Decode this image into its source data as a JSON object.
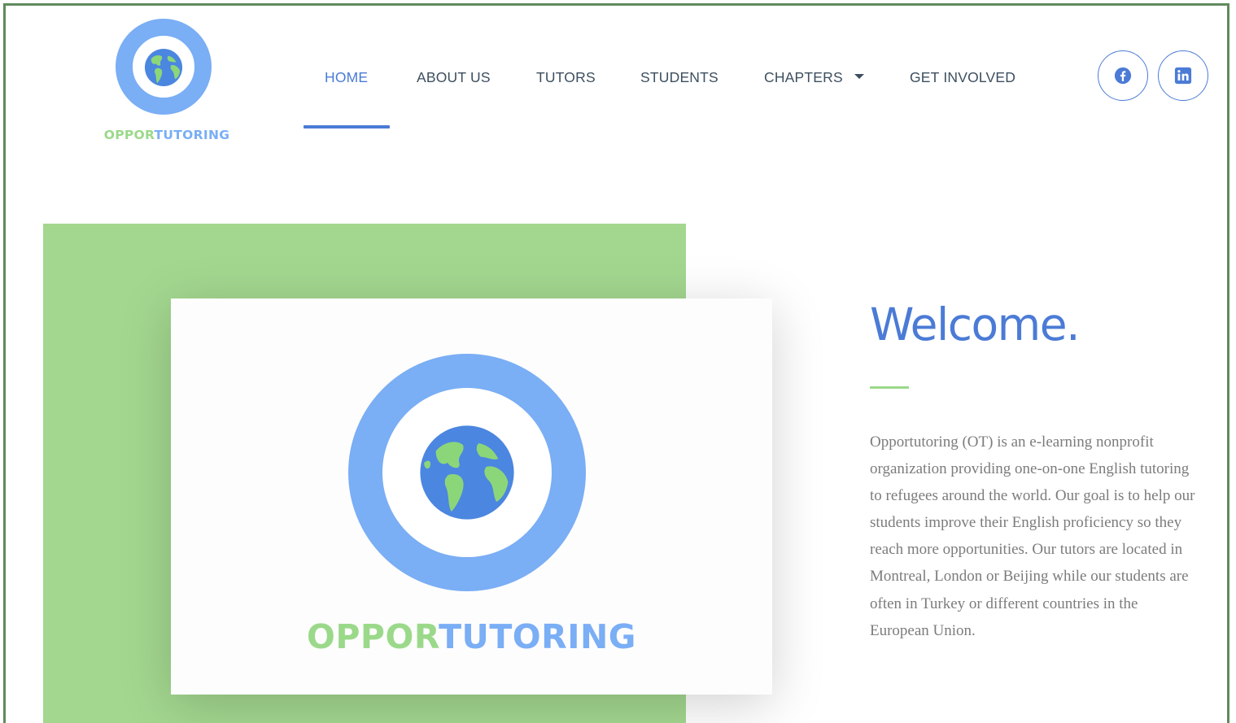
{
  "brand": {
    "logo_word_part1": "OPPOR",
    "logo_word_part2": "TUTORING",
    "colors": {
      "green": "#9bd98a",
      "blue": "#7aaef5",
      "accent": "#4b7bd6",
      "hero_green": "#a3d78f"
    }
  },
  "nav": {
    "items": [
      {
        "label": "HOME",
        "active": true
      },
      {
        "label": "ABOUT US"
      },
      {
        "label": "TUTORS"
      },
      {
        "label": "STUDENTS"
      },
      {
        "label": "CHAPTERS",
        "has_dropdown": true
      },
      {
        "label": "GET INVOLVED"
      }
    ],
    "dropdown_icon": "caret-down-icon"
  },
  "social": [
    {
      "icon": "facebook-icon"
    },
    {
      "icon": "linkedin-icon"
    }
  ],
  "hero": {
    "card_word_part1": "OPPOR",
    "card_word_part2": "TUTORING"
  },
  "welcome": {
    "heading": "Welcome.",
    "paragraph": "Opportutoring (OT) is an e-learning nonprofit organization providing one-on-one English tutoring to refugees around the world. Our goal is to help our students improve their English proficiency so they reach more opportunities. Our tutors are located in Montreal, London or Beijing while our students are often in Turkey or different countries in the European Union."
  }
}
